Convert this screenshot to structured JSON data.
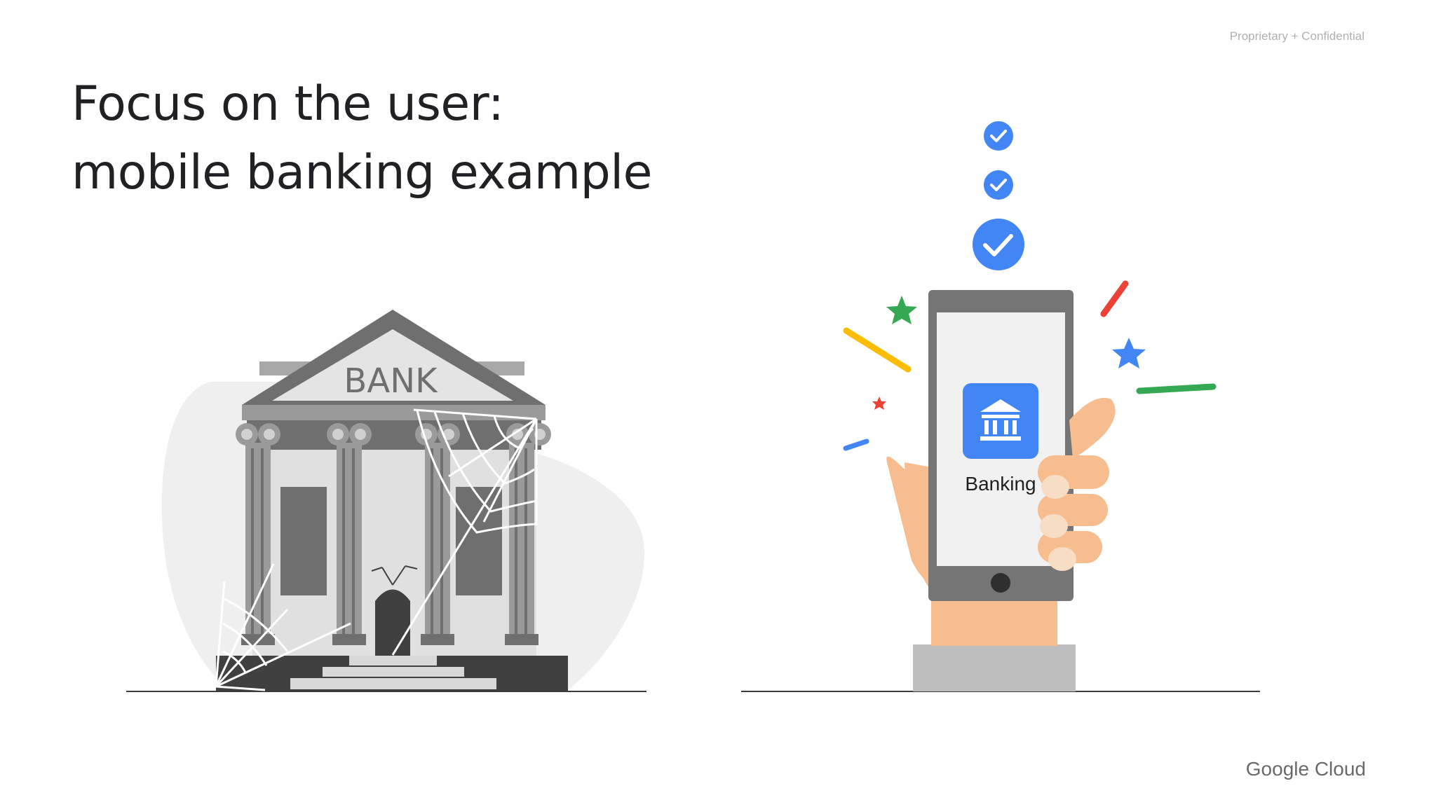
{
  "slide": {
    "confidential_label": "Proprietary + Confidential",
    "title_line1": "Focus on the user:",
    "title_line2": "mobile banking example",
    "brand": "Google Cloud"
  },
  "bank": {
    "sign_text": "BANK"
  },
  "phone": {
    "app_label": "Banking",
    "app_icon": "bank-building-icon"
  },
  "colors": {
    "accent_blue": "#4285f4",
    "google_red": "#ea4335",
    "google_yellow": "#fbbc04",
    "google_green": "#34a853",
    "skin": "#f8bd8f"
  }
}
